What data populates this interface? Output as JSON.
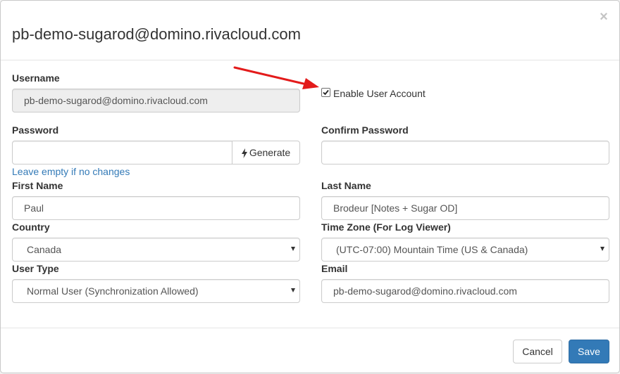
{
  "dialog": {
    "title": "pb-demo-sugarod@domino.rivacloud.com",
    "close_glyph": "×"
  },
  "form": {
    "username": {
      "label": "Username",
      "value": "pb-demo-sugarod@domino.rivacloud.com"
    },
    "enable_account": {
      "label": "Enable User Account",
      "checked": true
    },
    "password": {
      "label": "Password",
      "value": "",
      "generate_label": "Generate",
      "help": "Leave empty if no changes"
    },
    "confirm_password": {
      "label": "Confirm Password",
      "value": ""
    },
    "first_name": {
      "label": "First Name",
      "value": "Paul"
    },
    "last_name": {
      "label": "Last Name",
      "value": "Brodeur [Notes + Sugar OD]"
    },
    "country": {
      "label": "Country",
      "value": "Canada"
    },
    "time_zone": {
      "label": "Time Zone (For Log Viewer)",
      "value": "(UTC-07:00) Mountain Time (US & Canada)"
    },
    "user_type": {
      "label": "User Type",
      "value": "Normal User (Synchronization Allowed)"
    },
    "email": {
      "label": "Email",
      "value": "pb-demo-sugarod@domino.rivacloud.com"
    }
  },
  "footer": {
    "cancel_label": "Cancel",
    "save_label": "Save"
  },
  "colors": {
    "primary": "#337ab7",
    "link": "#337ab7",
    "annotation_arrow": "#e31b1b",
    "readonly_bg": "#eeeeee"
  },
  "icons": {
    "close": "close-icon",
    "generate": "lightning-bolt-icon",
    "select": "caret-down-icon",
    "checkbox": "checkmark-icon",
    "annotation": "red-arrow-icon"
  }
}
